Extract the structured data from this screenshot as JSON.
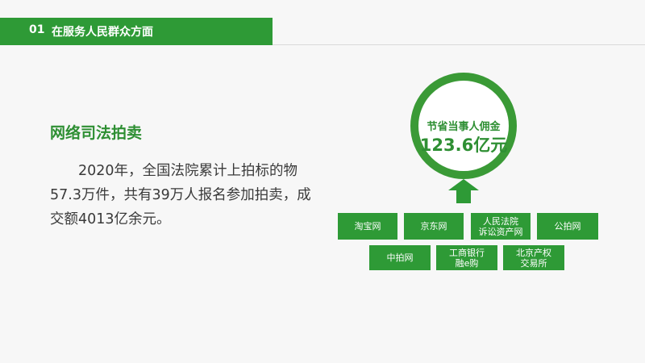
{
  "header": {
    "number": "01",
    "title": "在服务人民群众方面"
  },
  "content": {
    "heading": "网络司法拍卖",
    "paragraph": "2020年，全国法院累计上拍标的物57.3万件，共有39万人报名参加拍卖，成交额4013亿余元。"
  },
  "ring": {
    "label": "节省当事人佣金",
    "value": "123.6亿元"
  },
  "platforms": [
    "淘宝网",
    "京东网",
    "人民法院\n诉讼资产网",
    "公拍网",
    "中拍网",
    "工商银行\n融e购",
    "北京产权\n交易所"
  ],
  "icons": {
    "arrow": "up-arrow-icon"
  },
  "colors": {
    "accent": "#2e9a36",
    "text": "#3a3a3a",
    "background": "#f7f7f7"
  }
}
